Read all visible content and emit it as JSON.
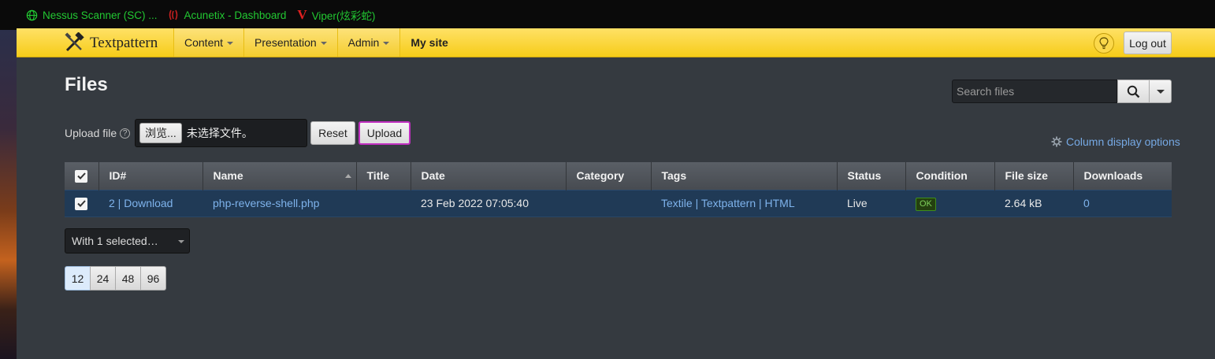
{
  "bookmarks": [
    {
      "label": "Nessus Scanner (SC) ...",
      "icon": "globe-icon"
    },
    {
      "label": "Acunetix - Dashboard",
      "icon": "acunetix-icon"
    },
    {
      "label": "Viper(炫彩蛇)",
      "icon": "viper-v-icon"
    }
  ],
  "header": {
    "brand": "Textpattern",
    "nav": [
      "Content",
      "Presentation",
      "Admin"
    ],
    "site_link": "My site",
    "logout": "Log out"
  },
  "page": {
    "title": "Files",
    "search_placeholder": "Search files"
  },
  "upload": {
    "label": "Upload file",
    "help": "?",
    "browse": "浏览...",
    "no_file": "未选择文件。",
    "reset": "Reset",
    "upload": "Upload"
  },
  "column_options": "Column display options",
  "table": {
    "headers": [
      "ID#",
      "Name",
      "Title",
      "Date",
      "Category",
      "Tags",
      "Status",
      "Condition",
      "File size",
      "Downloads"
    ],
    "rows": [
      {
        "id": "2 | Download",
        "name": "php-reverse-shell.php",
        "title": "",
        "date": "23 Feb 2022 07:05:40",
        "category": "",
        "tags": "Textile | Textpattern | HTML",
        "status": "Live",
        "condition": "OK",
        "size": "2.64 kB",
        "downloads": "0"
      }
    ]
  },
  "bulk_select": "With 1 selected…",
  "pagination": [
    "12",
    "24",
    "48",
    "96"
  ],
  "colors": {
    "accent": "#f6cc18",
    "link": "#7eb3ec",
    "selected_row": "#203a56",
    "background": "#353a40"
  }
}
